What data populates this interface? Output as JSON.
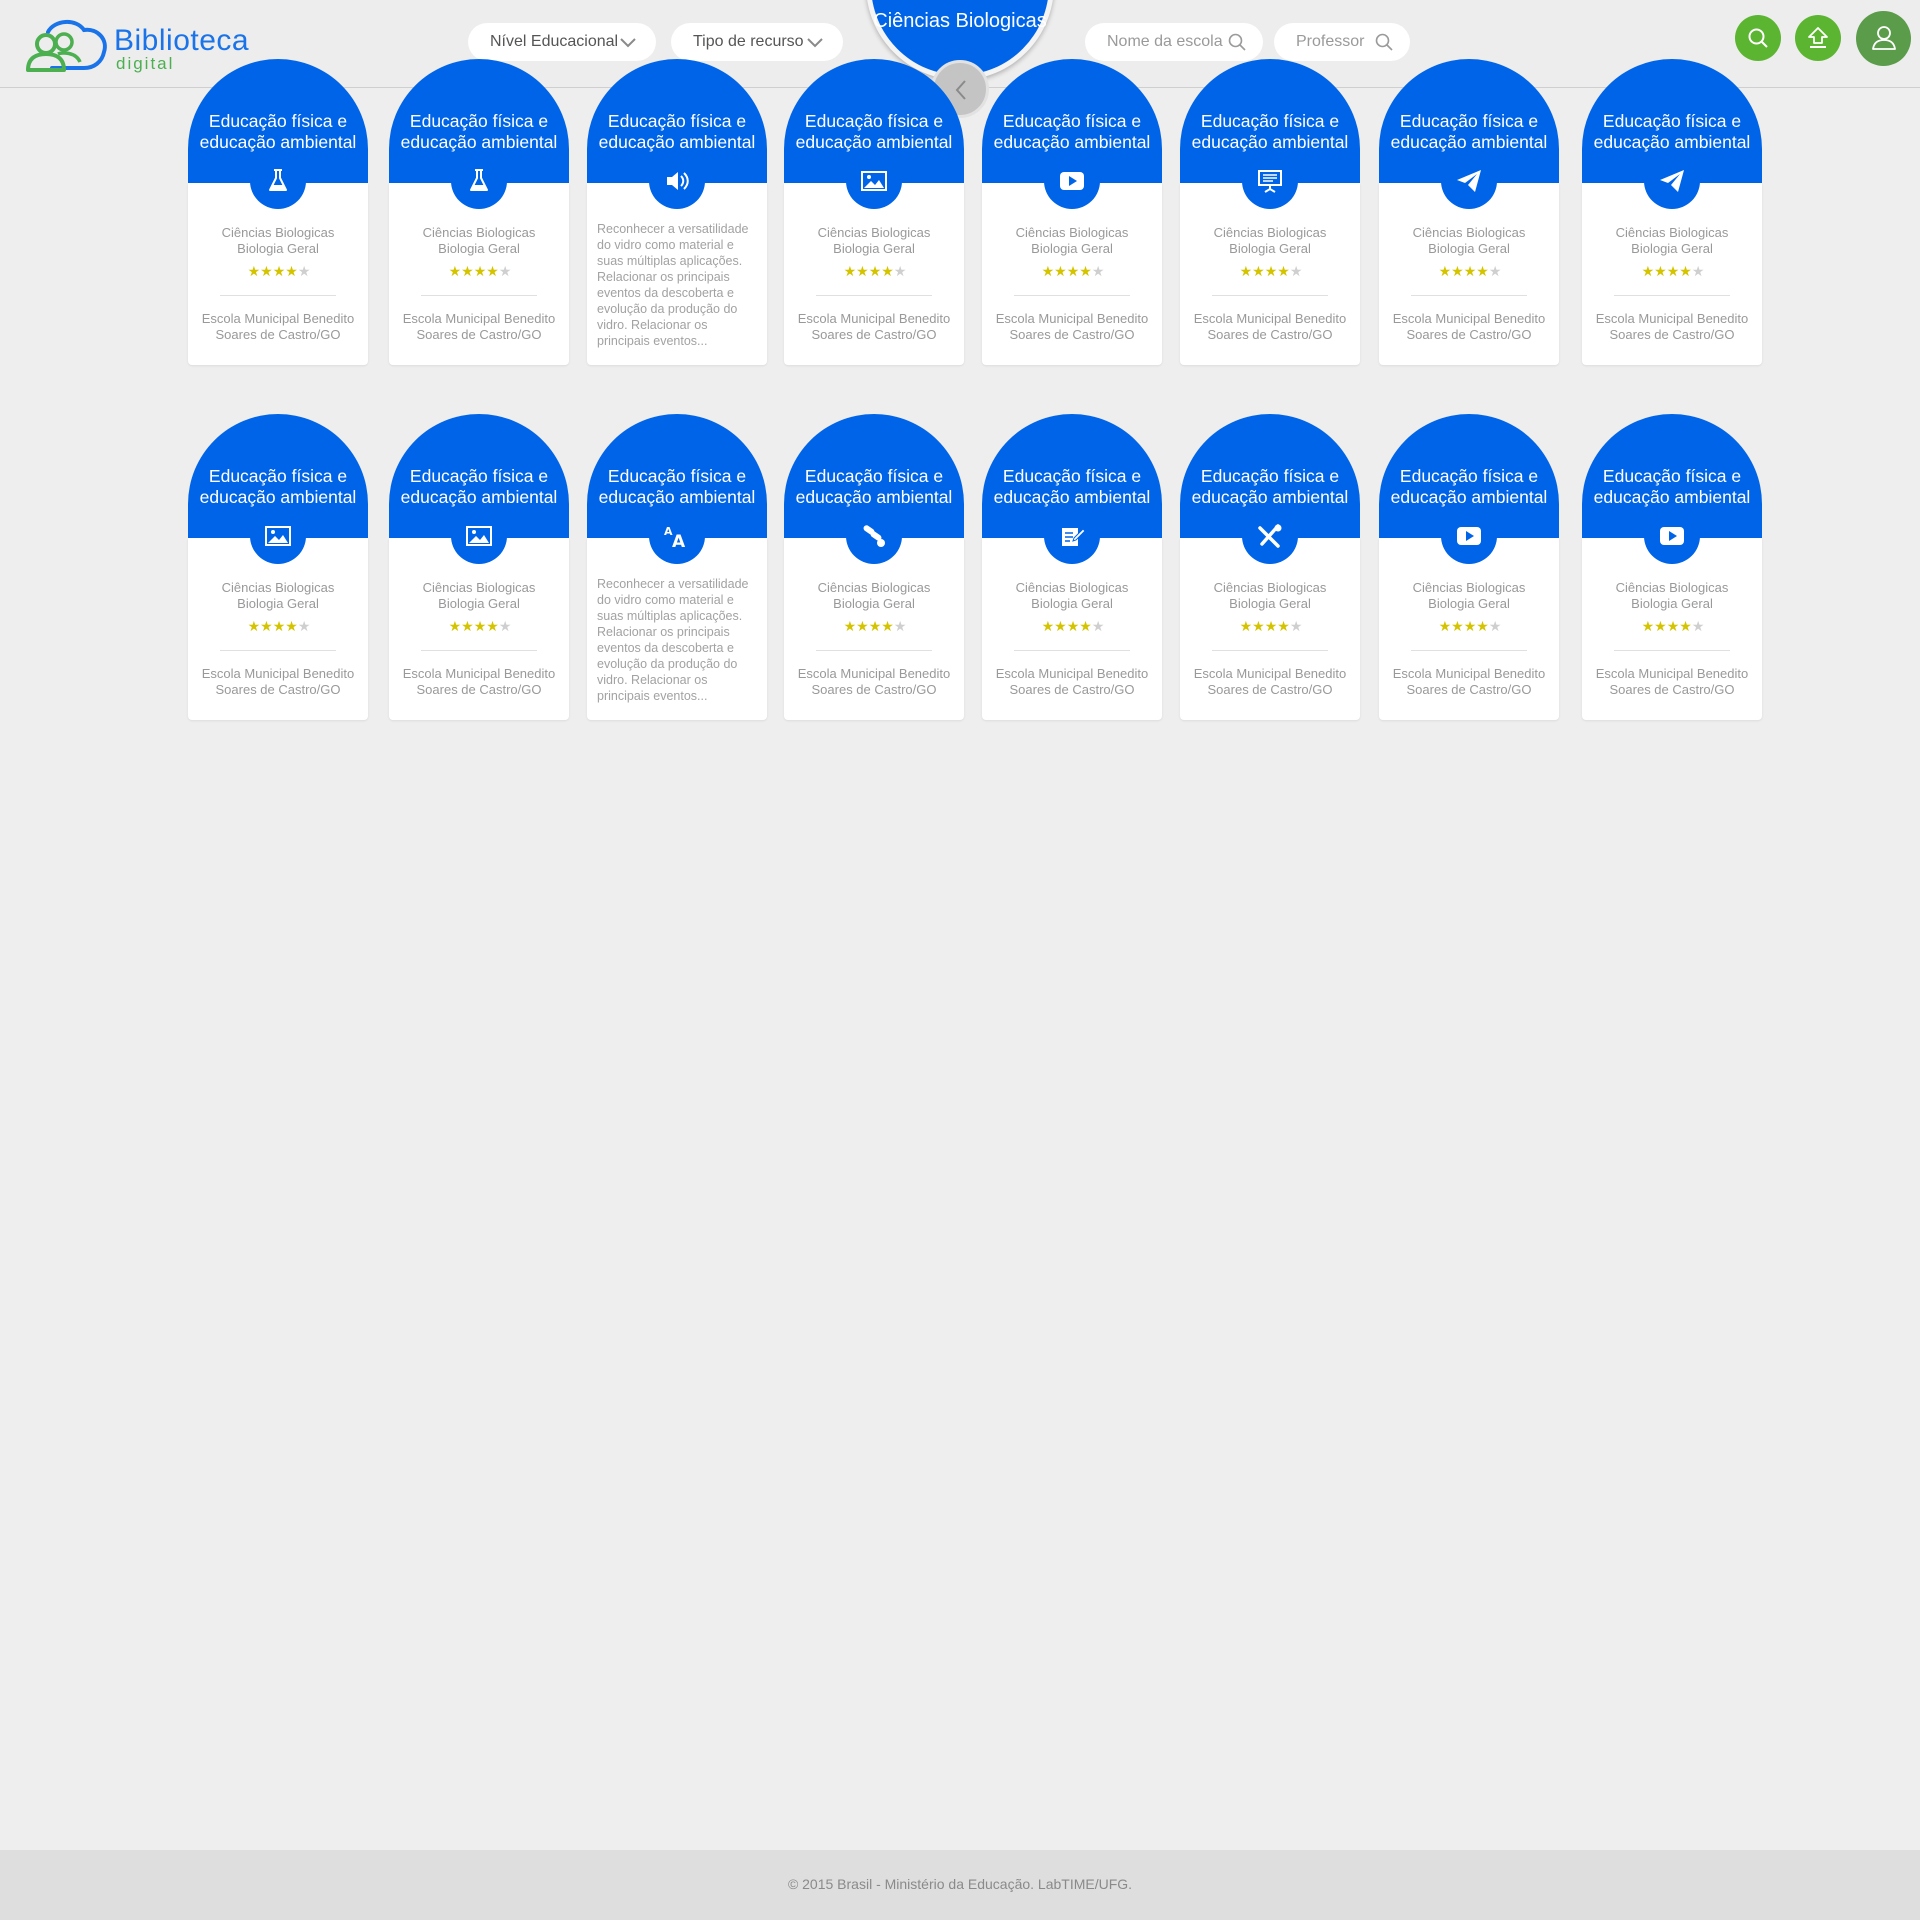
{
  "header": {
    "logo_line1": "Biblioteca",
    "logo_line2": "digital",
    "filter_level": "Nível Educacional",
    "filter_type": "Tipo de recurso",
    "subject_title": "Ciências Biologicas",
    "search_school_placeholder": "Nome da escola",
    "search_teacher_placeholder": "Professor"
  },
  "colors": {
    "primary": "#0064e8",
    "green": "#5cb531",
    "star": "#d4c400",
    "background": "#eeeeee"
  },
  "cards": [
    {
      "title": "Educação física e educação ambiental",
      "icon": "flask-icon",
      "subject": "Ciências Biologicas",
      "topic": "Biologia Geral",
      "rating": 4,
      "school": "Escola Municipal Benedito Soares de Castro/GO"
    },
    {
      "title": "Educação física e educação ambiental",
      "icon": "flask-icon",
      "subject": "Ciências Biologicas",
      "topic": "Biologia Geral",
      "rating": 4,
      "school": "Escola Municipal Benedito Soares de Castro/GO"
    },
    {
      "title": "Educação física e educação ambiental",
      "icon": "audio-icon",
      "description": "Reconhecer a versatilidade do vidro como material e suas múltiplas aplicações. Relacionar os principais eventos da descoberta e evolução da produção do vidro. Relacionar os principais eventos..."
    },
    {
      "title": "Educação física e educação ambiental",
      "icon": "image-icon",
      "subject": "Ciências Biologicas",
      "topic": "Biologia Geral",
      "rating": 4,
      "school": "Escola Municipal Benedito Soares de Castro/GO"
    },
    {
      "title": "Educação física e educação ambiental",
      "icon": "video-icon",
      "subject": "Ciências Biologicas",
      "topic": "Biologia Geral",
      "rating": 4,
      "school": "Escola Municipal Benedito Soares de Castro/GO"
    },
    {
      "title": "Educação física e educação ambiental",
      "icon": "presentation-icon",
      "subject": "Ciências Biologicas",
      "topic": "Biologia Geral",
      "rating": 4,
      "school": "Escola Municipal Benedito Soares de Castro/GO"
    },
    {
      "title": "Educação física e educação ambiental",
      "icon": "paper-plane-icon",
      "subject": "Ciências Biologicas",
      "topic": "Biologia Geral",
      "rating": 4,
      "school": "Escola Municipal Benedito Soares de Castro/GO"
    },
    {
      "title": "Educação física e educação ambiental",
      "icon": "paper-plane-icon",
      "subject": "Ciências Biologicas",
      "topic": "Biologia Geral",
      "rating": 4,
      "school": "Escola Municipal Benedito Soares de Castro/GO"
    },
    {
      "title": "Educação física e educação ambiental",
      "icon": "image-icon",
      "subject": "Ciências Biologicas",
      "topic": "Biologia Geral",
      "rating": 4,
      "school": "Escola Municipal Benedito Soares de Castro/GO"
    },
    {
      "title": "Educação física e educação ambiental",
      "icon": "image-icon",
      "subject": "Ciências Biologicas",
      "topic": "Biologia Geral",
      "rating": 4,
      "school": "Escola Municipal Benedito Soares de Castro/GO"
    },
    {
      "title": "Educação física e educação ambiental",
      "icon": "text-icon",
      "description": "Reconhecer a versatilidade do vidro como material e suas múltiplas aplicações. Relacionar os principais eventos da descoberta e evolução da produção do vidro. Relacionar os principais eventos..."
    },
    {
      "title": "Educação física e educação ambiental",
      "icon": "pills-icon",
      "subject": "Ciências Biologicas",
      "topic": "Biologia Geral",
      "rating": 4,
      "school": "Escola Municipal Benedito Soares de Castro/GO"
    },
    {
      "title": "Educação física e educação ambiental",
      "icon": "edit-document-icon",
      "subject": "Ciências Biologicas",
      "topic": "Biologia Geral",
      "rating": 4,
      "school": "Escola Municipal Benedito Soares de Castro/GO"
    },
    {
      "title": "Educação física e educação ambiental",
      "icon": "tools-icon",
      "subject": "Ciências Biologicas",
      "topic": "Biologia Geral",
      "rating": 4,
      "school": "Escola Municipal Benedito Soares de Castro/GO"
    },
    {
      "title": "Educação física e educação ambiental",
      "icon": "video-icon",
      "subject": "Ciências Biologicas",
      "topic": "Biologia Geral",
      "rating": 4,
      "school": "Escola Municipal Benedito Soares de Castro/GO"
    },
    {
      "title": "Educação física e educação ambiental",
      "icon": "video-icon",
      "subject": "Ciências Biologicas",
      "topic": "Biologia Geral",
      "rating": 4,
      "school": "Escola Municipal Benedito Soares de Castro/GO"
    }
  ],
  "footer": {
    "copyright": "© 2015 Brasil - Ministério da Educação. LabTIME/UFG."
  }
}
